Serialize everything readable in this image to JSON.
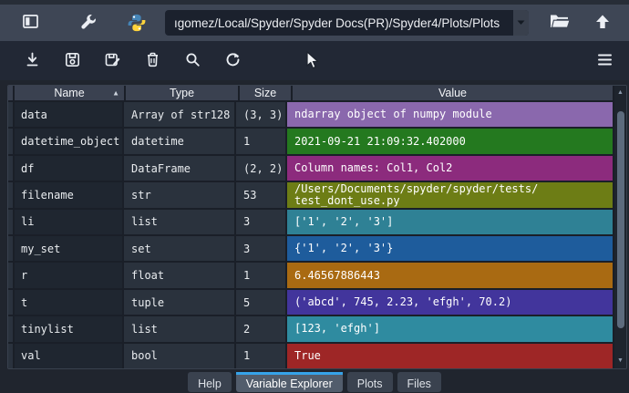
{
  "toolbar_top": {
    "path_value": "ıgomez/Local/Spyder/Spyder Docs(PR)/Spyder4/Plots/Plots",
    "dropdown_glyph": "▾",
    "icons": [
      "window-layout-icon",
      "wrench-icon",
      "python-logo-icon",
      "chevron-down-icon",
      "folder-open-icon",
      "arrow-up-icon"
    ]
  },
  "toolbar_actions": {
    "icons": [
      "import-data-icon",
      "save-data-icon",
      "save-data-as-icon",
      "remove-variable-icon",
      "search-icon",
      "refresh-icon",
      "hamburger-menu-icon"
    ]
  },
  "table": {
    "columns": [
      "Name",
      "Type",
      "Size",
      "Value"
    ],
    "sort_indicator": "▲",
    "rows": [
      {
        "name": "data",
        "type": "Array of str128",
        "size": "(3, 3)",
        "value": "ndarray object of numpy module",
        "color": "#8a68ad"
      },
      {
        "name": "datetime_object",
        "type": "datetime",
        "size": "1",
        "value": "2021-09-21 21:09:32.402000",
        "color": "#24791f"
      },
      {
        "name": "df",
        "type": "DataFrame",
        "size": "(2, 2)",
        "value": "Column names: Col1, Col2",
        "color": "#8c2b7d"
      },
      {
        "name": "filename",
        "type": "str",
        "size": "53",
        "value": "/Users/Documents/spyder/spyder/tests/\ntest_dont_use.py",
        "color": "#6d7d15"
      },
      {
        "name": "li",
        "type": "list",
        "size": "3",
        "value": "['1', '2', '3']",
        "color": "#2f8195"
      },
      {
        "name": "my_set",
        "type": "set",
        "size": "3",
        "value": "{'1', '2', '3'}",
        "color": "#1e5c9c"
      },
      {
        "name": "r",
        "type": "float",
        "size": "1",
        "value": "6.46567886443",
        "color": "#a96a12"
      },
      {
        "name": "t",
        "type": "tuple",
        "size": "5",
        "value": "('abcd', 745, 2.23, 'efgh', 70.2)",
        "color": "#42359c"
      },
      {
        "name": "tinylist",
        "type": "list",
        "size": "2",
        "value": "[123, 'efgh']",
        "color": "#2f8ba0"
      },
      {
        "name": "val",
        "type": "bool",
        "size": "1",
        "value": "True",
        "color": "#9e2626"
      }
    ]
  },
  "tabs": [
    {
      "label": "Help",
      "active": false
    },
    {
      "label": "Variable Explorer",
      "active": true
    },
    {
      "label": "Plots",
      "active": false
    },
    {
      "label": "Files",
      "active": false
    }
  ],
  "colors": {
    "active_tab_accent": "#36a3e9",
    "toolbar_top_bg": "#3e4655",
    "toolbar_actions_bg": "#222835",
    "panel_bg": "#20252e"
  }
}
